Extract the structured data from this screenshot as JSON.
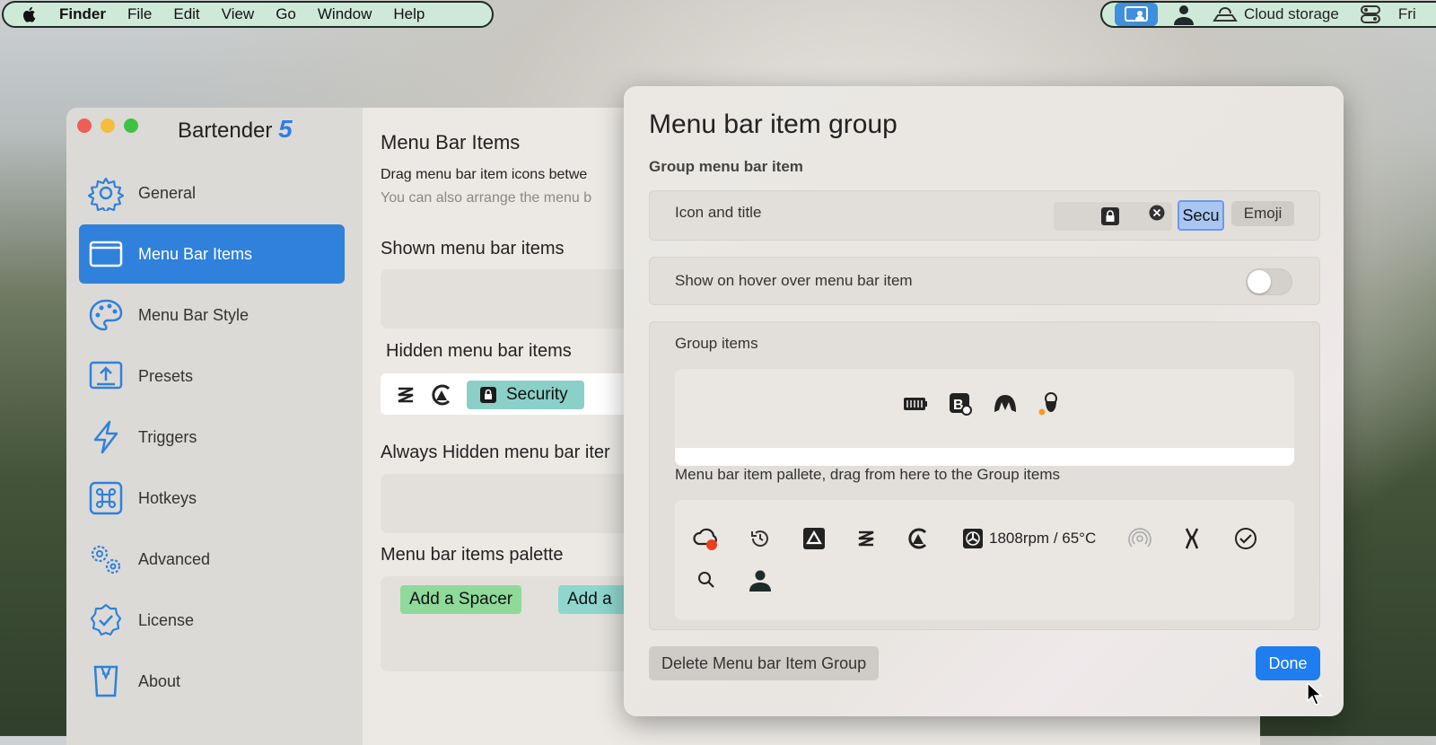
{
  "menubar": {
    "app": "Finder",
    "menus": [
      "File",
      "Edit",
      "View",
      "Go",
      "Window",
      "Help"
    ],
    "right_items": {
      "cloud_label": "Cloud storage",
      "clock": "Fri"
    }
  },
  "window": {
    "brand_name": "Bartender",
    "brand_version": "5",
    "nav": [
      {
        "label": "General",
        "icon": "gear-icon"
      },
      {
        "label": "Menu Bar Items",
        "icon": "window-icon",
        "active": true
      },
      {
        "label": "Menu Bar Style",
        "icon": "palette-icon"
      },
      {
        "label": "Presets",
        "icon": "upload-icon"
      },
      {
        "label": "Triggers",
        "icon": "bolt-icon"
      },
      {
        "label": "Hotkeys",
        "icon": "command-icon"
      },
      {
        "label": "Advanced",
        "icon": "gears-icon"
      },
      {
        "label": "License",
        "icon": "badge-check-icon"
      },
      {
        "label": "About",
        "icon": "tuxedo-icon"
      }
    ],
    "content": {
      "title": "Menu Bar Items",
      "desc1": "Drag menu bar item icons betwe",
      "desc2": "You can also arrange the menu b",
      "shown_title": "Shown menu bar items",
      "hidden_title": "Hidden menu bar items",
      "hidden_security_label": "Security",
      "always_hidden_title": "Always Hidden menu bar iter",
      "palette_title": "Menu bar items palette",
      "add_spacer": "Add a Spacer",
      "add_other": "Add a"
    }
  },
  "sheet": {
    "title": "Menu bar item group",
    "subtitle": "Group menu bar item",
    "icon_title_label": "Icon and title",
    "title_field_value": "Secu",
    "emoji_button": "Emoji",
    "hover_label": "Show on hover over menu bar item",
    "hover_enabled": false,
    "group_items_label": "Group items",
    "palette_label": "Menu bar item pallete, drag from here to the Group items",
    "fan_readout": "1808rpm / 65°C",
    "delete_button": "Delete Menu bar Item Group",
    "done_button": "Done"
  },
  "colors": {
    "accent": "#2f81dc",
    "done": "#1f7df0",
    "security_pill": "#8ad0c8",
    "spacer_green": "#8fd99a",
    "teal_button": "#8fd6cf"
  }
}
